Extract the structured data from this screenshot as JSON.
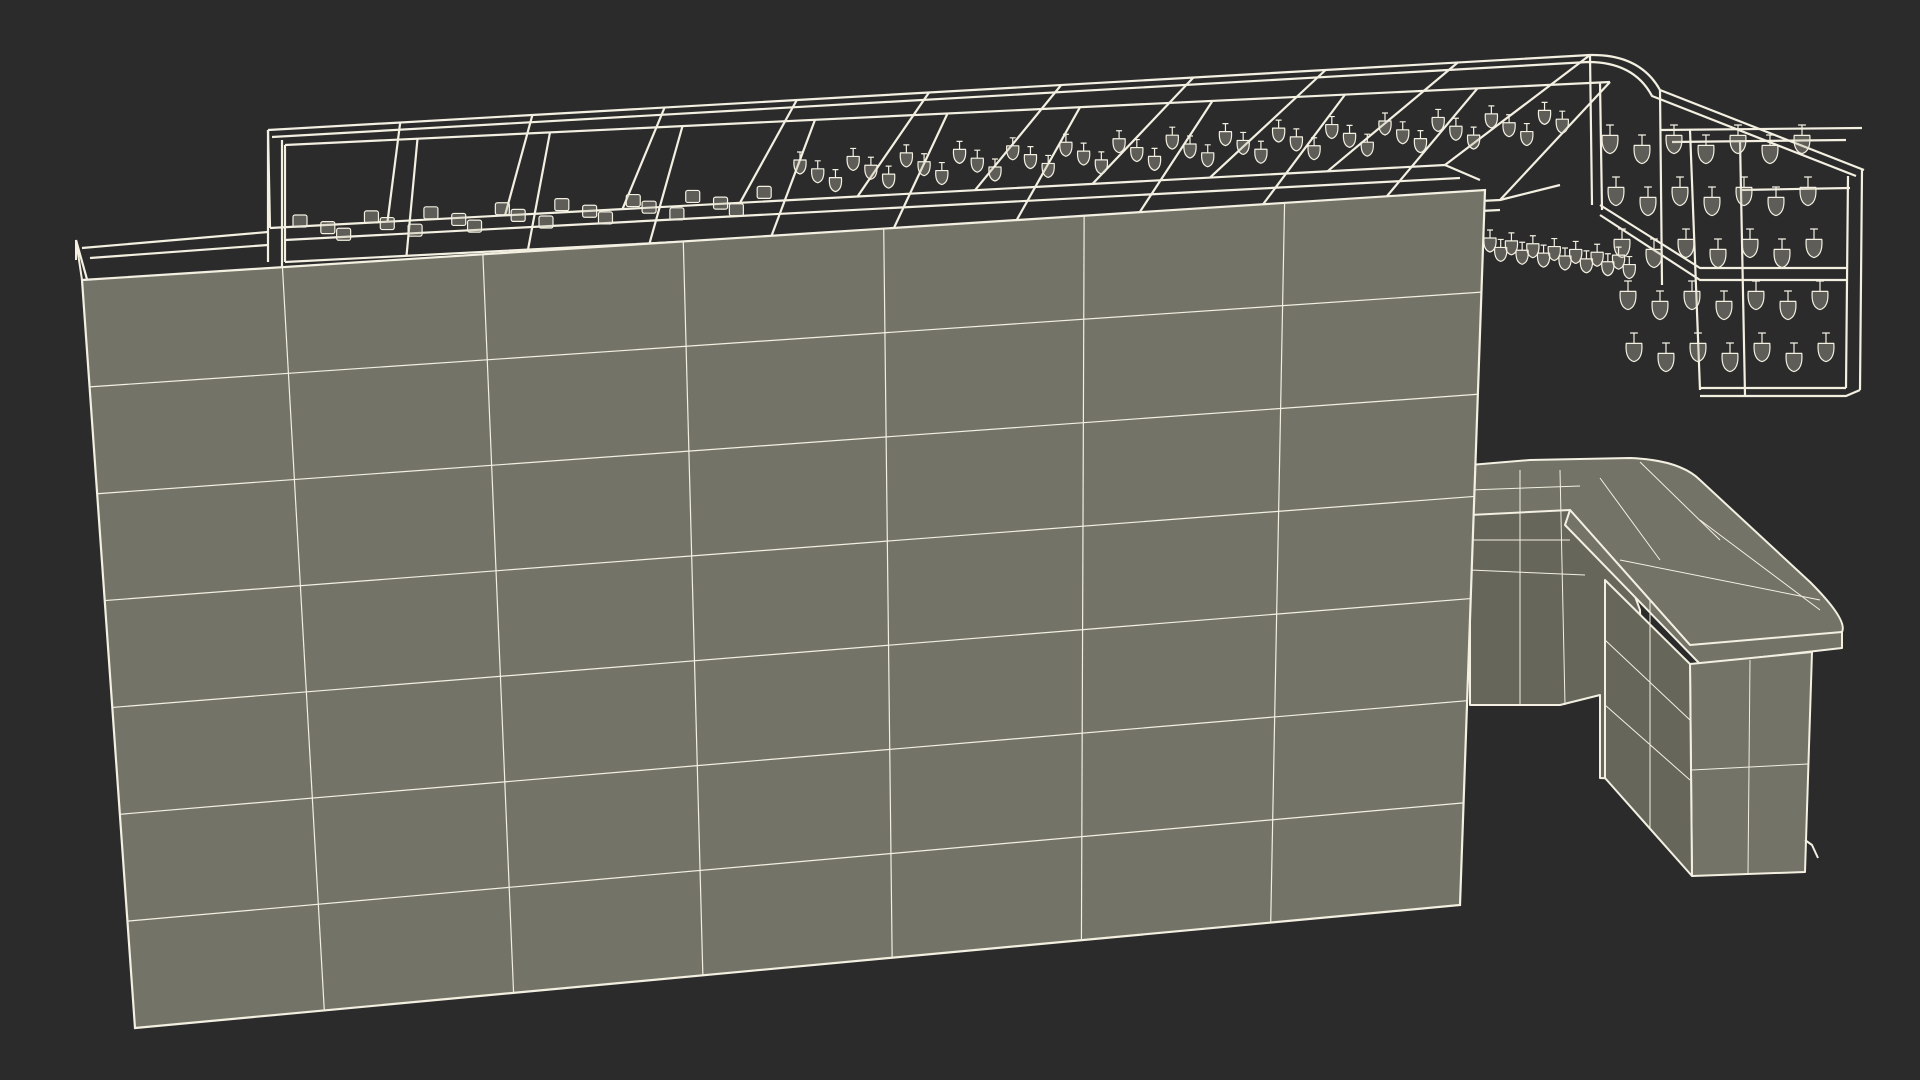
{
  "scene": {
    "subject": "bar-counter-wireframe",
    "colors": {
      "background": "#2b2b2b",
      "surface": "#737367",
      "surface_dark": "#66665b",
      "wire": "#f3f0e2",
      "wire_soft": "#d9d6c6"
    }
  }
}
